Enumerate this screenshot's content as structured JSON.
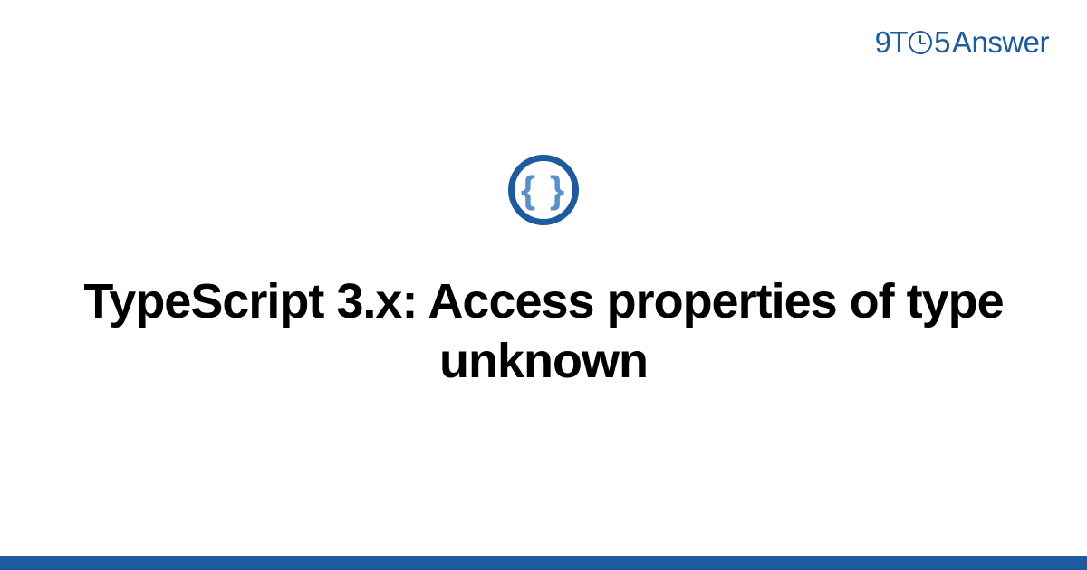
{
  "logo": {
    "nine": "9",
    "t": "T",
    "five": "5",
    "answer": "Answer"
  },
  "icon": {
    "braces": "{ }"
  },
  "title": "TypeScript 3.x: Access properties of type unknown"
}
